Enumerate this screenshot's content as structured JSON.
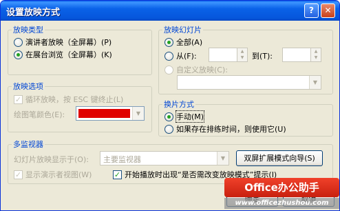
{
  "window": {
    "title": "设置放映方式",
    "help_btn": "?",
    "close_btn": "✕"
  },
  "show_type": {
    "legend": "放映类型",
    "options": [
      {
        "label": "演讲者放映（全屏幕）(P)",
        "selected": false
      },
      {
        "label": "在展台浏览（全屏幕）(K)",
        "selected": true
      }
    ]
  },
  "show_options": {
    "legend": "放映选项",
    "loop_label": "循环放映，按 ESC 键终止(L)",
    "loop_checked": true,
    "pen_color_label": "绘图笔颜色(E):",
    "pen_color": "#e00000"
  },
  "slides": {
    "legend": "放映幻灯片",
    "all_label": "全部(A)",
    "from_label": "从(F):",
    "to_label": "到(T):",
    "from_value": "",
    "to_value": "",
    "custom_label": "自定义放映(C):",
    "custom_value": "",
    "selected": "all"
  },
  "advance": {
    "legend": "换片方式",
    "options": [
      {
        "label": "手动(M)",
        "selected": true
      },
      {
        "label": "如果存在排练时间，则使用它(U)",
        "selected": false
      }
    ]
  },
  "monitors": {
    "legend": "多监视器",
    "display_on_label": "幻灯片放映显示于(O):",
    "display_on_value": "主要监视器",
    "presenter_view_label": "显示演示者视图(W)",
    "presenter_view_checked": true,
    "wizard_button": "双屏扩展模式向导(S)",
    "prompt_label": "开始播放时出现“是否需改变放映模式”提示(I)",
    "prompt_checked": true
  },
  "buttons": {
    "ok": "确定",
    "cancel": "取消"
  },
  "watermark": {
    "brand": "Office办公助手",
    "url": "www.officezhushou.com"
  }
}
